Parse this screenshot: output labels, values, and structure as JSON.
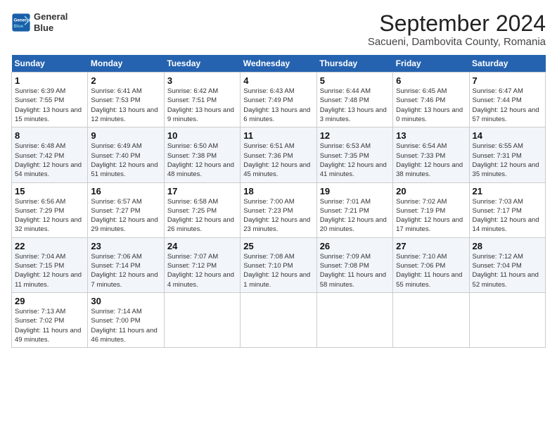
{
  "header": {
    "logo_line1": "General",
    "logo_line2": "Blue",
    "month_title": "September 2024",
    "subtitle": "Sacueni, Dambovita County, Romania"
  },
  "days_of_week": [
    "Sunday",
    "Monday",
    "Tuesday",
    "Wednesday",
    "Thursday",
    "Friday",
    "Saturday"
  ],
  "weeks": [
    [
      {
        "day": "1",
        "sunrise": "6:39 AM",
        "sunset": "7:55 PM",
        "daylight": "13 hours and 15 minutes."
      },
      {
        "day": "2",
        "sunrise": "6:41 AM",
        "sunset": "7:53 PM",
        "daylight": "13 hours and 12 minutes."
      },
      {
        "day": "3",
        "sunrise": "6:42 AM",
        "sunset": "7:51 PM",
        "daylight": "13 hours and 9 minutes."
      },
      {
        "day": "4",
        "sunrise": "6:43 AM",
        "sunset": "7:49 PM",
        "daylight": "13 hours and 6 minutes."
      },
      {
        "day": "5",
        "sunrise": "6:44 AM",
        "sunset": "7:48 PM",
        "daylight": "13 hours and 3 minutes."
      },
      {
        "day": "6",
        "sunrise": "6:45 AM",
        "sunset": "7:46 PM",
        "daylight": "13 hours and 0 minutes."
      },
      {
        "day": "7",
        "sunrise": "6:47 AM",
        "sunset": "7:44 PM",
        "daylight": "12 hours and 57 minutes."
      }
    ],
    [
      {
        "day": "8",
        "sunrise": "6:48 AM",
        "sunset": "7:42 PM",
        "daylight": "12 hours and 54 minutes."
      },
      {
        "day": "9",
        "sunrise": "6:49 AM",
        "sunset": "7:40 PM",
        "daylight": "12 hours and 51 minutes."
      },
      {
        "day": "10",
        "sunrise": "6:50 AM",
        "sunset": "7:38 PM",
        "daylight": "12 hours and 48 minutes."
      },
      {
        "day": "11",
        "sunrise": "6:51 AM",
        "sunset": "7:36 PM",
        "daylight": "12 hours and 45 minutes."
      },
      {
        "day": "12",
        "sunrise": "6:53 AM",
        "sunset": "7:35 PM",
        "daylight": "12 hours and 41 minutes."
      },
      {
        "day": "13",
        "sunrise": "6:54 AM",
        "sunset": "7:33 PM",
        "daylight": "12 hours and 38 minutes."
      },
      {
        "day": "14",
        "sunrise": "6:55 AM",
        "sunset": "7:31 PM",
        "daylight": "12 hours and 35 minutes."
      }
    ],
    [
      {
        "day": "15",
        "sunrise": "6:56 AM",
        "sunset": "7:29 PM",
        "daylight": "12 hours and 32 minutes."
      },
      {
        "day": "16",
        "sunrise": "6:57 AM",
        "sunset": "7:27 PM",
        "daylight": "12 hours and 29 minutes."
      },
      {
        "day": "17",
        "sunrise": "6:58 AM",
        "sunset": "7:25 PM",
        "daylight": "12 hours and 26 minutes."
      },
      {
        "day": "18",
        "sunrise": "7:00 AM",
        "sunset": "7:23 PM",
        "daylight": "12 hours and 23 minutes."
      },
      {
        "day": "19",
        "sunrise": "7:01 AM",
        "sunset": "7:21 PM",
        "daylight": "12 hours and 20 minutes."
      },
      {
        "day": "20",
        "sunrise": "7:02 AM",
        "sunset": "7:19 PM",
        "daylight": "12 hours and 17 minutes."
      },
      {
        "day": "21",
        "sunrise": "7:03 AM",
        "sunset": "7:17 PM",
        "daylight": "12 hours and 14 minutes."
      }
    ],
    [
      {
        "day": "22",
        "sunrise": "7:04 AM",
        "sunset": "7:15 PM",
        "daylight": "12 hours and 11 minutes."
      },
      {
        "day": "23",
        "sunrise": "7:06 AM",
        "sunset": "7:14 PM",
        "daylight": "12 hours and 7 minutes."
      },
      {
        "day": "24",
        "sunrise": "7:07 AM",
        "sunset": "7:12 PM",
        "daylight": "12 hours and 4 minutes."
      },
      {
        "day": "25",
        "sunrise": "7:08 AM",
        "sunset": "7:10 PM",
        "daylight": "12 hours and 1 minute."
      },
      {
        "day": "26",
        "sunrise": "7:09 AM",
        "sunset": "7:08 PM",
        "daylight": "11 hours and 58 minutes."
      },
      {
        "day": "27",
        "sunrise": "7:10 AM",
        "sunset": "7:06 PM",
        "daylight": "11 hours and 55 minutes."
      },
      {
        "day": "28",
        "sunrise": "7:12 AM",
        "sunset": "7:04 PM",
        "daylight": "11 hours and 52 minutes."
      }
    ],
    [
      {
        "day": "29",
        "sunrise": "7:13 AM",
        "sunset": "7:02 PM",
        "daylight": "11 hours and 49 minutes."
      },
      {
        "day": "30",
        "sunrise": "7:14 AM",
        "sunset": "7:00 PM",
        "daylight": "11 hours and 46 minutes."
      },
      null,
      null,
      null,
      null,
      null
    ]
  ]
}
